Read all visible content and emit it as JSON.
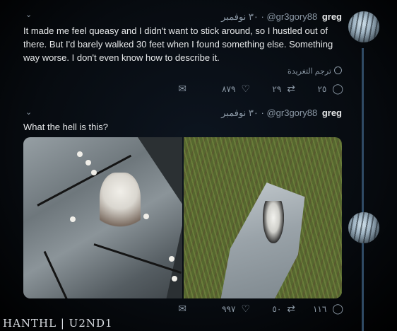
{
  "tweets": [
    {
      "name": "greg",
      "handle": "@gr3gory88",
      "date": "٣٠ نوفمبر",
      "text": "It made me feel queasy and I didn't want to stick around, so I hustled out of there. But I'd barely walked 30 feet when I found something else. Something way worse. I don't even know how to describe it.",
      "translate_label": "ترجم التغريدة",
      "replies": "٢٥",
      "retweets": "٢٩",
      "likes": "٨٧٩"
    },
    {
      "name": "greg",
      "handle": "@gr3gory88",
      "date": "٣٠ نوفمبر",
      "text": "What the hell is this?",
      "replies": "١١٦",
      "retweets": "٥٠",
      "likes": "٩٩٧"
    }
  ],
  "icons": {
    "reply": "speech-bubble-icon",
    "retweet": "retweet-icon",
    "like": "heart-icon",
    "share": "share-icon",
    "menu": "chevron-down-icon",
    "globe": "globe-icon"
  },
  "watermark": "HANTHL | U2ND1",
  "colors": {
    "background": "#000000",
    "text": "#e7e9ea",
    "muted": "#8b98a5",
    "thread_line": "#2f4a64"
  }
}
